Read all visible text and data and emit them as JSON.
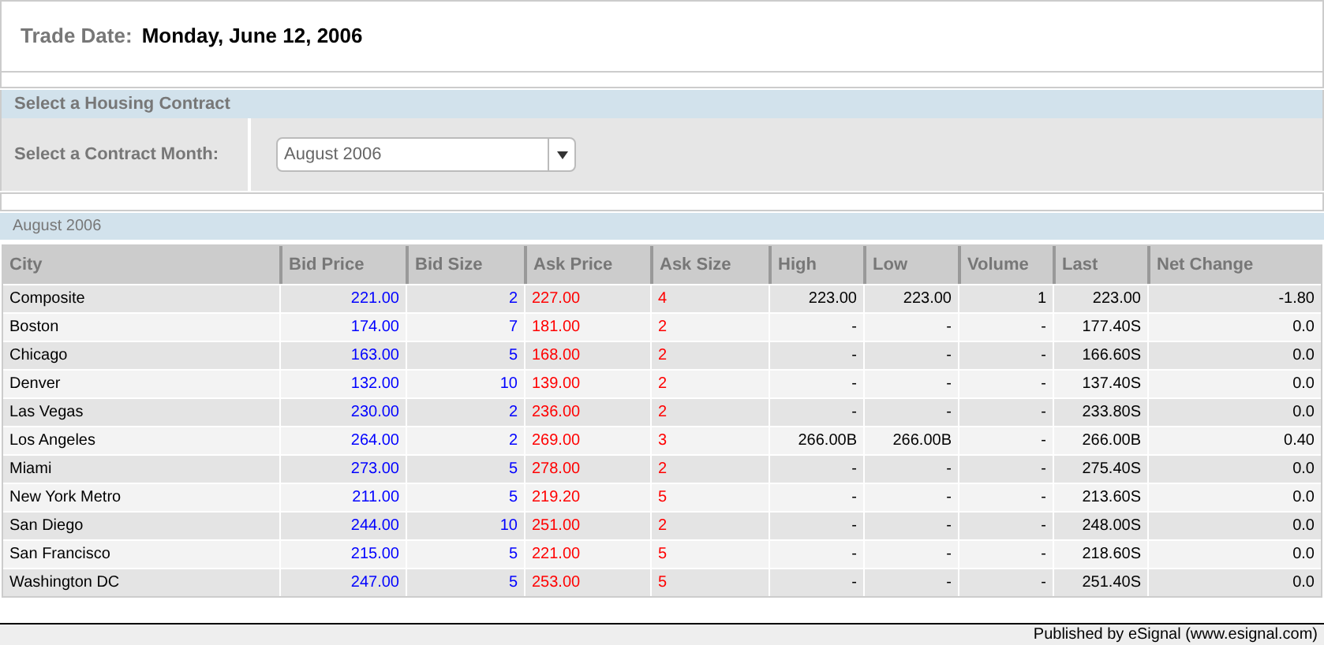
{
  "trade_date": {
    "label": "Trade Date:",
    "value": "Monday, June 12, 2006"
  },
  "contract_panel": {
    "title": "Select a Housing Contract",
    "field_label": "Select a Contract Month:",
    "dropdown": {
      "value": "August 2006"
    }
  },
  "table": {
    "title": "August 2006",
    "columns": [
      "City",
      "Bid Price",
      "Bid Size",
      "Ask Price",
      "Ask Size",
      "High",
      "Low",
      "Volume",
      "Last",
      "Net Change"
    ],
    "rows": [
      [
        "Composite",
        "221.00",
        "2",
        "227.00",
        "4",
        "223.00",
        "223.00",
        "1",
        "223.00",
        "-1.80"
      ],
      [
        "Boston",
        "174.00",
        "7",
        "181.00",
        "2",
        "-",
        "-",
        "-",
        "177.40S",
        "0.0"
      ],
      [
        "Chicago",
        "163.00",
        "5",
        "168.00",
        "2",
        "-",
        "-",
        "-",
        "166.60S",
        "0.0"
      ],
      [
        "Denver",
        "132.00",
        "10",
        "139.00",
        "2",
        "-",
        "-",
        "-",
        "137.40S",
        "0.0"
      ],
      [
        "Las Vegas",
        "230.00",
        "2",
        "236.00",
        "2",
        "-",
        "-",
        "-",
        "233.80S",
        "0.0"
      ],
      [
        "Los Angeles",
        "264.00",
        "2",
        "269.00",
        "3",
        "266.00B",
        "266.00B",
        "-",
        "266.00B",
        "0.40"
      ],
      [
        "Miami",
        "273.00",
        "5",
        "278.00",
        "2",
        "-",
        "-",
        "-",
        "275.40S",
        "0.0"
      ],
      [
        "New York Metro",
        "211.00",
        "5",
        "219.20",
        "5",
        "-",
        "-",
        "-",
        "213.60S",
        "0.0"
      ],
      [
        "San Diego",
        "244.00",
        "10",
        "251.00",
        "2",
        "-",
        "-",
        "-",
        "248.00S",
        "0.0"
      ],
      [
        "San Francisco",
        "215.00",
        "5",
        "221.00",
        "5",
        "-",
        "-",
        "-",
        "218.60S",
        "0.0"
      ],
      [
        "Washington DC",
        "247.00",
        "5",
        "253.00",
        "5",
        "-",
        "-",
        "-",
        "251.40S",
        "0.0"
      ]
    ]
  },
  "footer": "Published by eSignal (www.esignal.com)"
}
